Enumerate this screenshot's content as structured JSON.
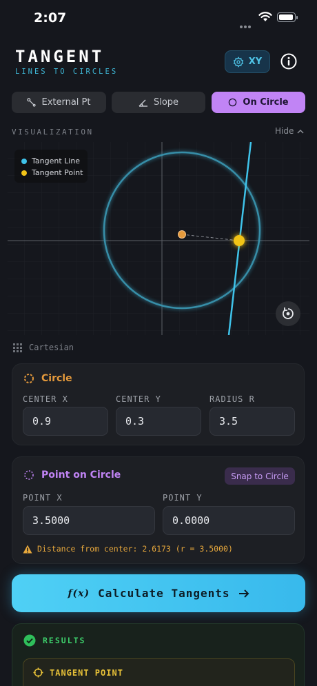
{
  "status_bar": {
    "time": "2:07"
  },
  "header": {
    "title": "TANGENT",
    "subtitle": "LINES TO CIRCLES",
    "coord_button": "XY",
    "coord_icon": "gear-icon",
    "info_icon": "info-icon"
  },
  "tabs": [
    {
      "label": "External Pt",
      "icon": "pen-tool-icon",
      "active": false
    },
    {
      "label": "Slope",
      "icon": "angle-icon",
      "active": false
    },
    {
      "label": "On Circle",
      "icon": "circle-icon",
      "active": true
    }
  ],
  "visualization": {
    "label": "VISUALIZATION",
    "hide_label": "Hide",
    "legend": [
      {
        "label": "Tangent Line",
        "color": "#3fc3ea"
      },
      {
        "label": "Tangent Point",
        "color": "#f2c418"
      }
    ],
    "coordinate_system": "Cartesian"
  },
  "circle": {
    "title": "Circle",
    "fields": [
      {
        "label": "CENTER X",
        "value": "0.9"
      },
      {
        "label": "CENTER Y",
        "value": "0.3"
      },
      {
        "label": "RADIUS R",
        "value": "3.5"
      }
    ]
  },
  "point_on_circle": {
    "title": "Point on Circle",
    "snap_label": "Snap to Circle",
    "fields": [
      {
        "label": "POINT X",
        "value": "3.5000"
      },
      {
        "label": "POINT Y",
        "value": "0.0000"
      }
    ],
    "warning": "Distance from center: 2.6173 (r = 3.5000)"
  },
  "calculate_button": {
    "icon_text": "f(x)",
    "label": "Calculate Tangents"
  },
  "results": {
    "label": "RESULTS",
    "tangent_point_label": "TANGENT POINT"
  },
  "colors": {
    "accent_cyan": "#3fc3ea",
    "accent_purple": "#c184f5",
    "accent_orange": "#e59a3c",
    "accent_yellow": "#f2c418",
    "success_green": "#3dcf6b"
  }
}
